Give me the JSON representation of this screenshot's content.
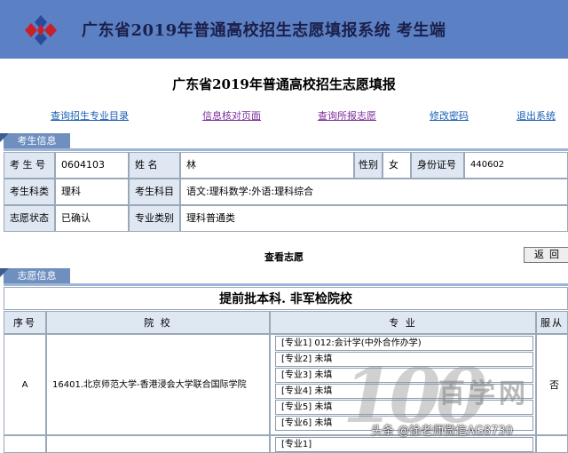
{
  "header": {
    "title": "广东省2019年普通高校招生志愿填报系统  考生端"
  },
  "page_title": "广东省2019年普通高校招生志愿填报",
  "nav": [
    {
      "label": "查询招生专业目录"
    },
    {
      "label": "信息核对页面"
    },
    {
      "label": "查询所报志愿"
    },
    {
      "label": "修改密码"
    },
    {
      "label": "退出系统"
    }
  ],
  "student_section": {
    "tab_label": "考生信息",
    "exam_no_label": "考 生 号",
    "exam_no": "0604103",
    "name_label": "姓    名",
    "name": "林",
    "gender_label": "性别",
    "gender": "女",
    "id_label": "身份证号",
    "id_no": "440602",
    "category_label": "考生科类",
    "category": "理科",
    "subjects_label": "考生科目",
    "subjects": "语文:理科数学:外语:理科综合",
    "status_label": "志愿状态",
    "status": "已确认",
    "major_type_label": "专业类别",
    "major_type": "理科普通类"
  },
  "view_title": "查看志愿",
  "back_button": "返回",
  "wish_section": {
    "tab_label": "志愿信息",
    "batch_title": "提前批本科. 非军检院校",
    "columns": {
      "index": "序号",
      "school": "院    校",
      "major": "专    业",
      "obey": "服从"
    },
    "row": {
      "index": "A",
      "school": "16401.北京师范大学-香港浸会大学联合国际学院",
      "majors": [
        "[专业1]  012:会计学(中外合作办学)",
        "[专业2]  未填",
        "[专业3]  未填",
        "[专业4]  未填",
        "[专业5]  未填",
        "[专业6]  未填"
      ],
      "obey": "否"
    },
    "next_row_first_major": "[专业1]"
  },
  "watermark": {
    "big": "100",
    "brand": "百学网",
    "caption": "头条 @徐老师微信AG8730"
  },
  "colors": {
    "banner": "#5b81c4",
    "label_bg": "#dfe7f3",
    "tab_bg": "#6f8fbf",
    "link_blue": "#1a5fb4",
    "link_purple": "#7a2a9a"
  }
}
